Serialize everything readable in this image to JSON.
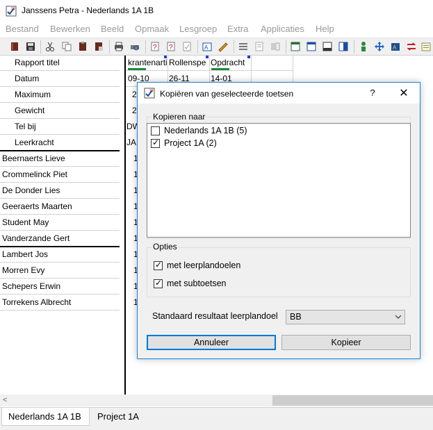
{
  "window": {
    "title": "Janssens Petra - Nederlands 1A 1B"
  },
  "menu": {
    "items": [
      "Bestand",
      "Bewerken",
      "Beeld",
      "Opmaak",
      "Lesgroep",
      "Extra",
      "Applicaties",
      "Help"
    ]
  },
  "grid": {
    "header_labels": [
      "Rapport titel",
      "Datum",
      "Maximum",
      "Gewicht",
      "Tel bij",
      "Leerkracht"
    ],
    "columns": [
      {
        "title": "krantenarti",
        "datum": "09-10",
        "maximum": "2",
        "gewicht": "2",
        "telbij": "DW",
        "leerkracht": "JA"
      },
      {
        "title": "Rollenspe",
        "datum": "26-11"
      },
      {
        "title": "Opdracht",
        "datum": "14-01"
      }
    ],
    "students": [
      {
        "name": "Beernaerts Lieve",
        "score": "1"
      },
      {
        "name": "Crommelinck Piet",
        "score": "1"
      },
      {
        "name": "De Donder Lies",
        "score": "1"
      },
      {
        "name": "Geeraerts Maarten",
        "score": "1"
      },
      {
        "name": "Student May",
        "score": "1"
      },
      {
        "name": "Vanderzande Gert",
        "score": "1"
      },
      {
        "name": "Lambert Jos",
        "score": "1"
      },
      {
        "name": "Morren Evy",
        "score": "1"
      },
      {
        "name": "Schepers Erwin",
        "score": "1"
      },
      {
        "name": "Torrekens Albrecht",
        "score": "1"
      }
    ]
  },
  "tabs": [
    "Nederlands 1A 1B",
    "Project 1A"
  ],
  "dialog": {
    "title": "Kopiëren van geselecteerde toetsen",
    "help_label": "?",
    "close_label": "✕",
    "copy_to_label": "Kopieren naar",
    "targets": [
      {
        "label": "Nederlands 1A 1B (5)",
        "checked": false
      },
      {
        "label": "Project 1A (2)",
        "checked": true
      }
    ],
    "options_label": "Opties",
    "options": [
      {
        "label": "met leerplandoelen",
        "checked": true
      },
      {
        "label": "met subtoetsen",
        "checked": true
      }
    ],
    "standard_result_label": "Standaard resultaat leerplandoel",
    "standard_result_value": "BB",
    "cancel_label": "Annuleer",
    "copy_label": "Kopieer"
  },
  "colors": {
    "accent": "#0078d7",
    "column_marker": "#1b8a3a"
  }
}
